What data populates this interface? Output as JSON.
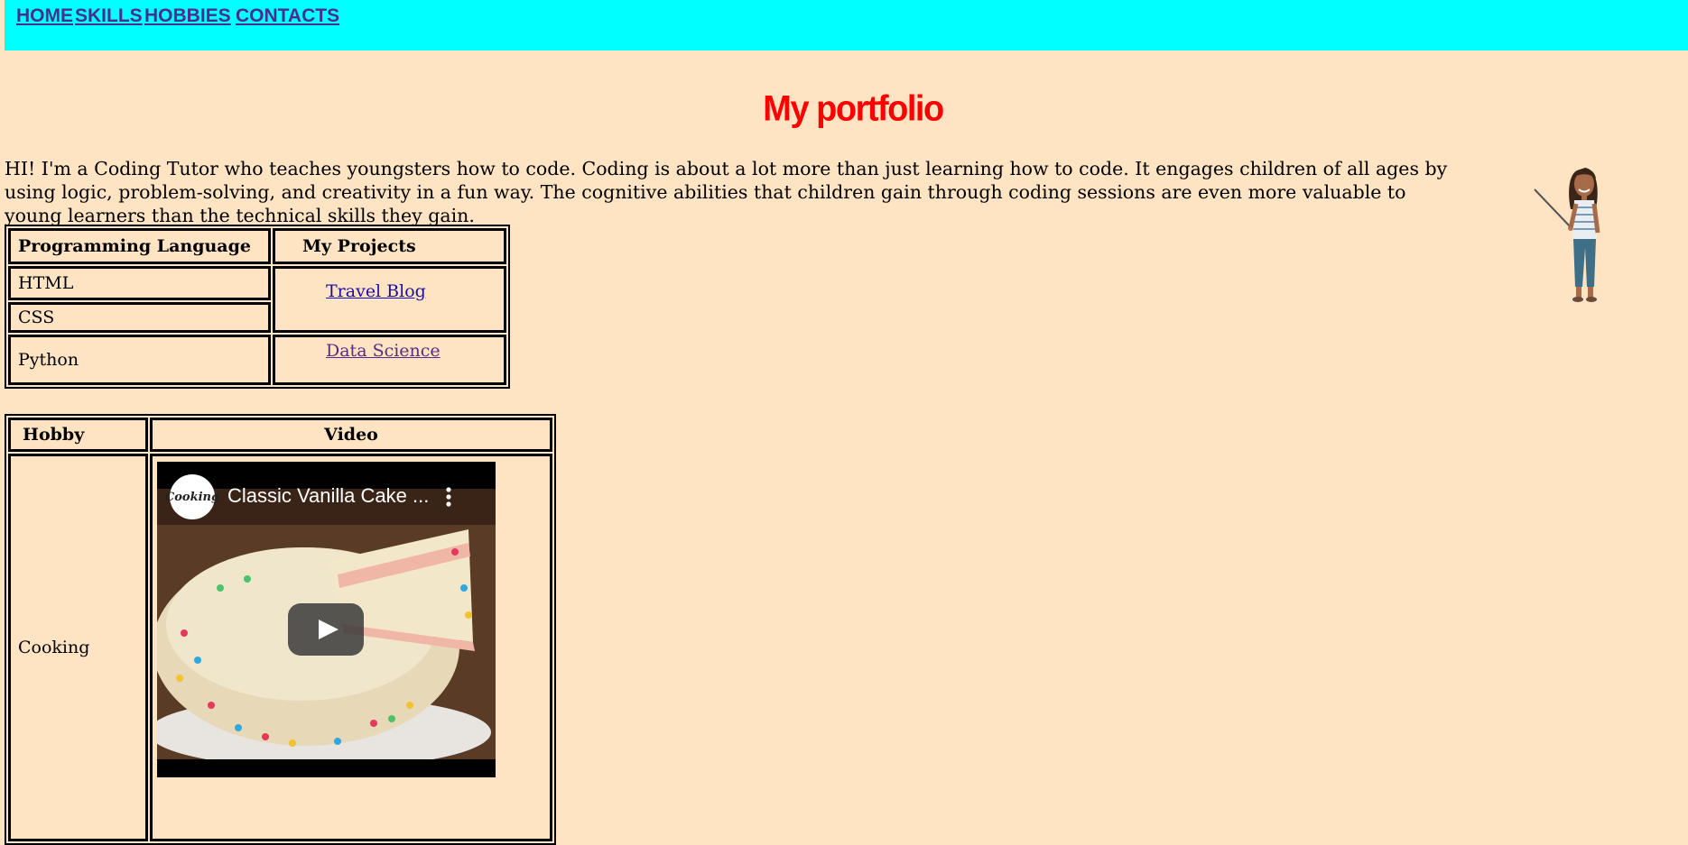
{
  "nav": {
    "home": "HOME",
    "skills": "SKILLS",
    "hobbies": "HOBBIES",
    "contacts": "CONTACTS"
  },
  "page": {
    "title": "My portfolio",
    "intro": "HI! I'm a Coding Tutor who teaches youngsters how to code. Coding is about a lot more than just learning how to code. It engages children of all ages by using logic, problem-solving, and creativity in a fun way. The cognitive abilities that children gain through coding sessions are even more valuable to young learners than the technical skills they gain."
  },
  "skills_table": {
    "headers": [
      "Programming Language",
      "My Projects"
    ],
    "languages": [
      "HTML",
      "CSS",
      "Python"
    ],
    "projects": [
      "Travel Blog",
      "Data Science"
    ]
  },
  "hobby_table": {
    "headers": [
      "Hobby",
      "Video"
    ],
    "hobby": "Cooking",
    "video": {
      "title": "Classic Vanilla Cake ...",
      "channel_logo_text": "Cooking"
    }
  },
  "colors": {
    "background": "#ffe4c4",
    "navbar": "#00ffff",
    "title": "#ff0000",
    "link": "#1a0dab"
  },
  "icons": [
    "teacher-illustration",
    "youtube-play-icon",
    "more-options-icon",
    "channel-logo"
  ]
}
